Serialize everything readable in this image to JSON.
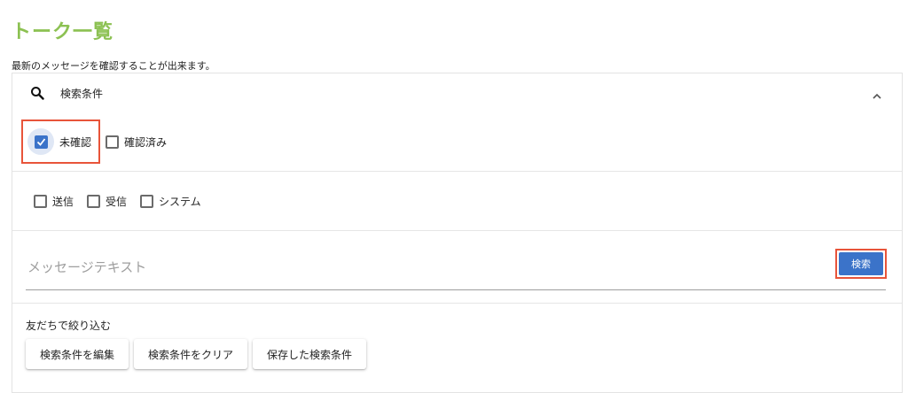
{
  "page": {
    "title": "トーク一覧",
    "description": "最新のメッセージを確認することが出来ます。"
  },
  "search_panel": {
    "header_label": "検索条件",
    "icons": {
      "search": "search-icon",
      "collapse": "chevron-up-icon"
    },
    "status_filters": [
      {
        "label": "未確認",
        "checked": true
      },
      {
        "label": "確認済み",
        "checked": false
      }
    ],
    "type_filters": [
      {
        "label": "送信",
        "checked": false
      },
      {
        "label": "受信",
        "checked": false
      },
      {
        "label": "システム",
        "checked": false
      }
    ],
    "message_input": {
      "placeholder": "メッセージテキスト",
      "value": ""
    },
    "search_button": "検索",
    "friend_filter_label": "友だちで絞り込む",
    "buttons": {
      "edit": "検索条件を編集",
      "clear": "検索条件をクリア",
      "saved": "保存した検索条件"
    }
  },
  "colors": {
    "title": "#8cc152",
    "accent": "#3b73c9",
    "highlight_border": "#e8543a"
  }
}
